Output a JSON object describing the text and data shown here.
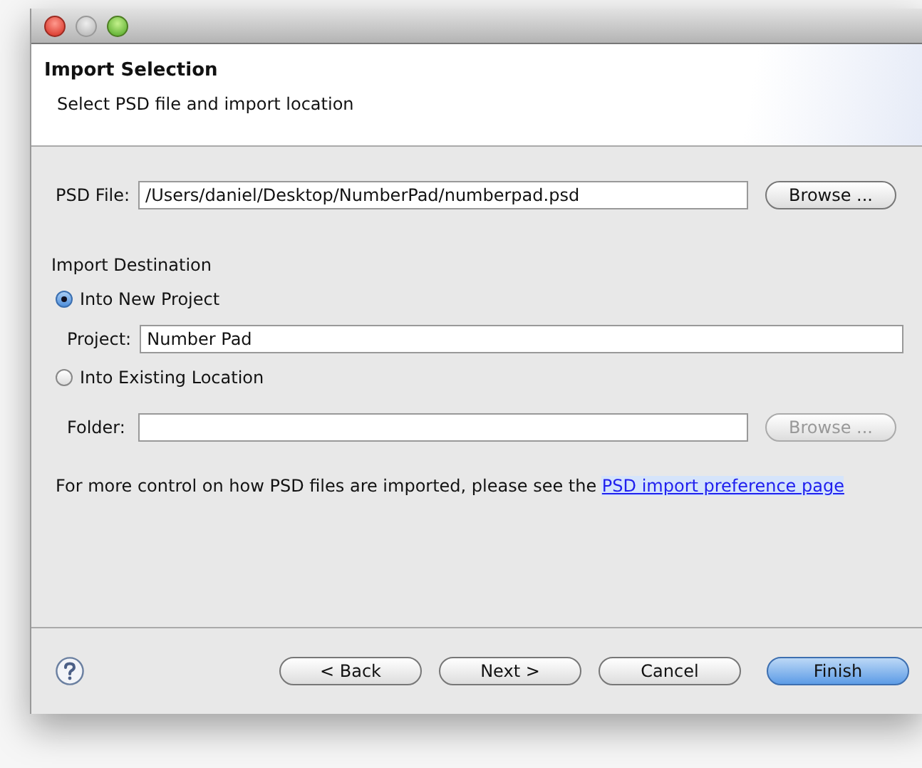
{
  "header": {
    "title": "Import Selection",
    "subtitle": "Select PSD file and import location"
  },
  "psd_file": {
    "label": "PSD File:",
    "value": "/Users/daniel/Desktop/NumberPad/numberpad.psd",
    "browse": {
      "label": "Browse ...",
      "disabled": false
    }
  },
  "destination": {
    "heading": "Import Destination",
    "options": [
      {
        "label": "Into New Project",
        "selected": true
      },
      {
        "label": "Into Existing Location",
        "selected": false
      }
    ],
    "project": {
      "label": "Project:",
      "value": "Number Pad"
    },
    "folder": {
      "label": "Folder:",
      "browse": {
        "label": "Browse ...",
        "disabled": true
      }
    }
  },
  "note": {
    "text": "For more control on how PSD files are imported, please see the",
    "link": "PSD import preference page"
  },
  "buttons": [
    {
      "label": "< Back",
      "default": false
    },
    {
      "label": "Next >",
      "default": false
    },
    {
      "label": "Cancel",
      "default": false
    },
    {
      "label": "Finish",
      "default": true
    }
  ]
}
